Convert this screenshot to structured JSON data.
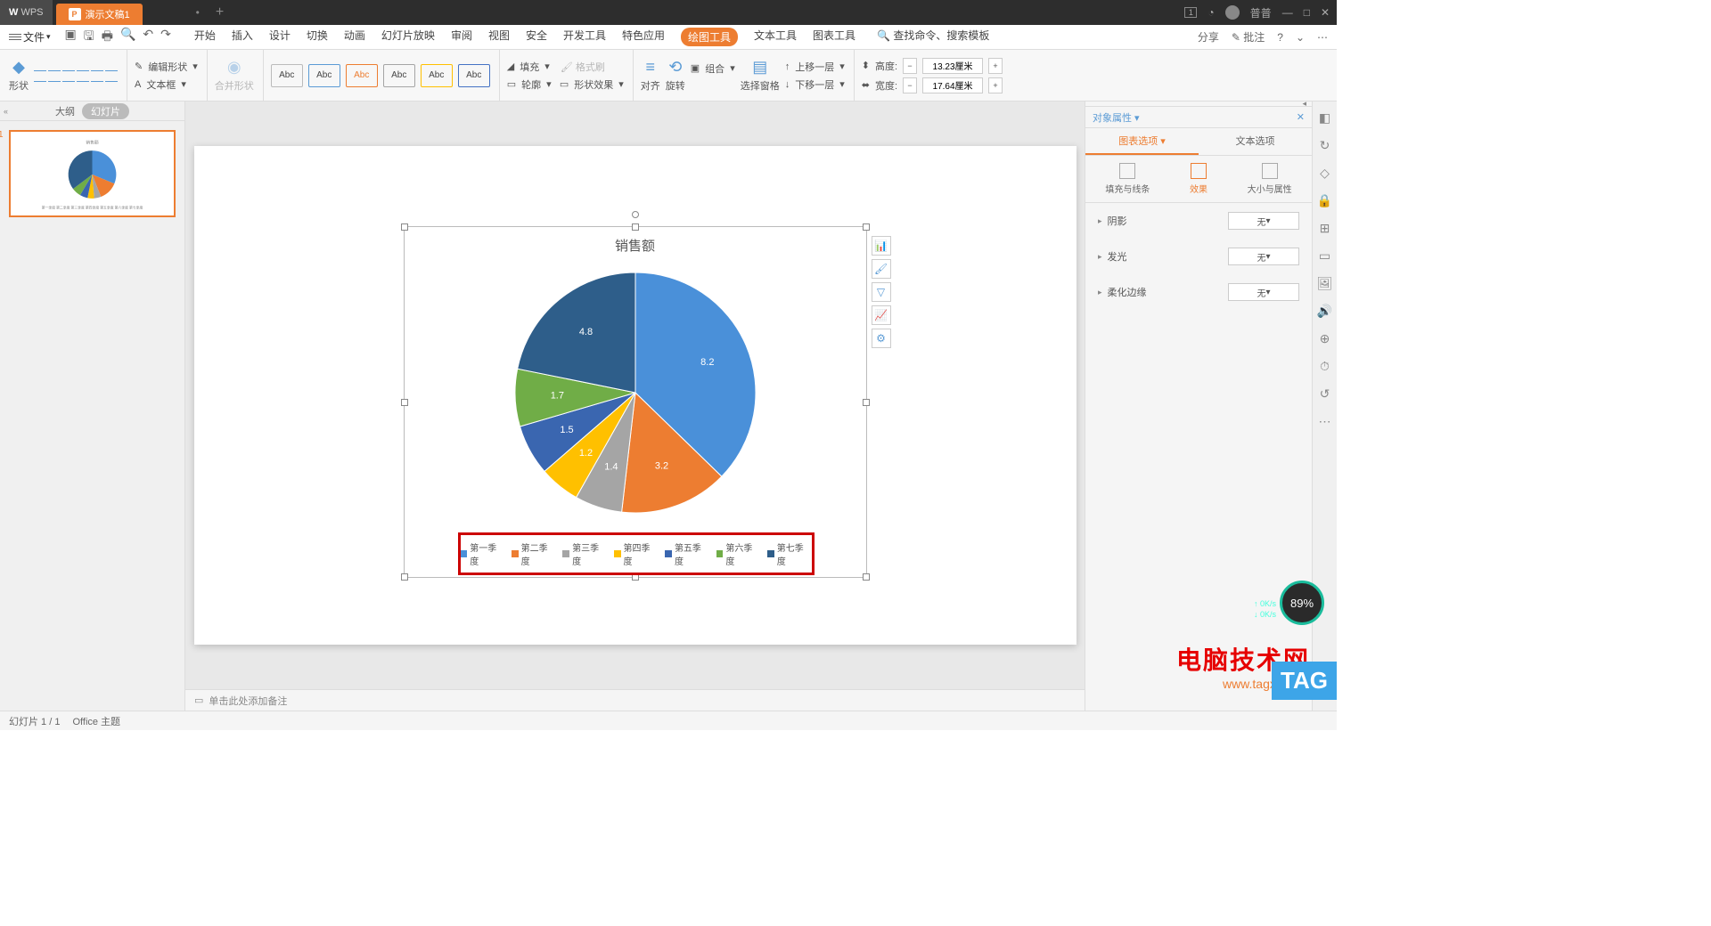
{
  "titlebar": {
    "app": "WPS",
    "doc": "演示文稿1",
    "user": "普普"
  },
  "menubar": {
    "file": "文件",
    "tabs": [
      "开始",
      "插入",
      "设计",
      "切换",
      "动画",
      "幻灯片放映",
      "审阅",
      "视图",
      "安全",
      "开发工具",
      "特色应用",
      "绘图工具",
      "文本工具",
      "图表工具"
    ],
    "active_tab": "绘图工具",
    "search": "查找命令、搜索模板",
    "share": "分享",
    "annotate": "批注"
  },
  "ribbon": {
    "shape": "形状",
    "edit_shape": "编辑形状",
    "textbox": "文本框",
    "merge": "合并形状",
    "fill": "填充",
    "format_brush": "格式刷",
    "outline": "轮廓",
    "effects": "形状效果",
    "align": "对齐",
    "rotate": "旋转",
    "combine": "组合",
    "select_pane": "选择窗格",
    "up_layer": "上移一层",
    "down_layer": "下移一层",
    "height_lbl": "高度:",
    "height_val": "13.23厘米",
    "width_lbl": "宽度:",
    "width_val": "17.64厘米",
    "abc": "Abc"
  },
  "slide_panel": {
    "outline": "大纲",
    "slides": "幻灯片",
    "num": "1"
  },
  "chart_data": {
    "type": "pie",
    "title": "销售额",
    "series": [
      {
        "name": "第一季度",
        "value": 8.2,
        "color": "#4a90d9"
      },
      {
        "name": "第二季度",
        "value": 3.2,
        "color": "#ed7d31"
      },
      {
        "name": "第三季度",
        "value": 1.4,
        "color": "#a5a5a5"
      },
      {
        "name": "第四季度",
        "value": 1.2,
        "color": "#ffc000"
      },
      {
        "name": "第五季度",
        "value": 1.5,
        "color": "#3a66b0"
      },
      {
        "name": "第六季度",
        "value": 1.7,
        "color": "#70ad47"
      },
      {
        "name": "第七季度",
        "value": 4.8,
        "color": "#2e5e8a"
      }
    ]
  },
  "notes": "单击此处添加备注",
  "prop_panel": {
    "title": "对象属性",
    "chart_opts": "图表选项",
    "text_opts": "文本选项",
    "sub": [
      "填充与线条",
      "效果",
      "大小与属性"
    ],
    "active_sub": "效果",
    "shadow": "阴影",
    "glow": "发光",
    "soft_edge": "柔化边缘",
    "none": "无"
  },
  "statusbar": {
    "slide": "幻灯片 1 / 1",
    "theme": "Office 主题"
  },
  "perf": {
    "pct": "89%",
    "net1": "0K/s",
    "net2": "0K/s"
  },
  "watermark": {
    "text": "电脑技术网",
    "url": "www.tagxp.com"
  },
  "tag": "TAG"
}
